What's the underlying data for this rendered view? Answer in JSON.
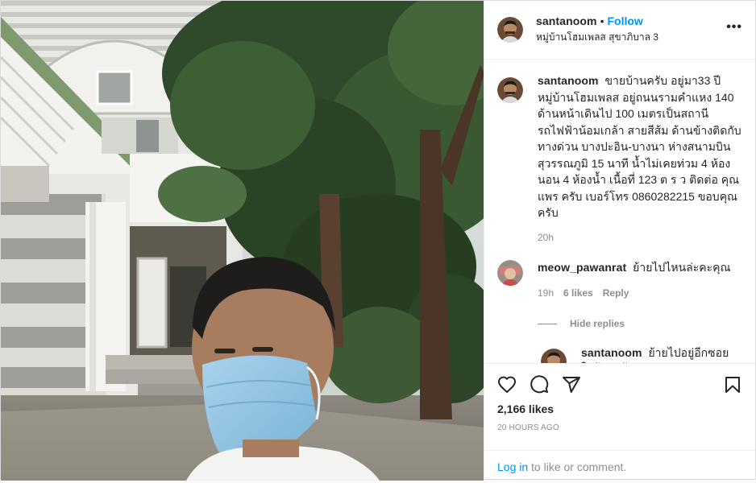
{
  "post": {
    "author": {
      "username": "santanoom",
      "follow_label": "Follow",
      "separator": "•",
      "location": "หมู่บ้านโฮมเพลส สุขาภิบาล 3"
    },
    "more_label": "•••",
    "caption": {
      "username": "santanoom",
      "text": "ขายบ้านครับ อยู่มา33 ปี หมู่บ้านโฮมเพลส อยู่ถนนรามคำแหง 140 ด้านหน้าเดินไป 100 เมตรเป็นสถานี รถไฟฟ้าน้อมเกล้า สายสีส้ม ด้านข้างติดกับทางด่วน บางปะอิน-บางนา ห่างสนามบิน สุวรรณภูมิ 15 นาที น้ำไม่เคยท่วม 4 ห้องนอน 4 ห้องน้ำ เนื้อที่ 123 ต ร ว ติดต่อ คุณแพร ครับ เบอร์โทร 0860282215 ขอบคุณครับ",
      "time": "20h"
    },
    "comments": [
      {
        "username": "meow_pawanrat",
        "text": "ย้ายไปไหนล่ะคะคุณ",
        "time": "19h",
        "likes": "6 likes",
        "reply_label": "Reply",
        "hide_replies_label": "Hide replies",
        "replies": [
          {
            "username": "santanoom",
            "text": "ย้ายไปอยู่อีกซอยใกล้ๆกันจ้า"
          }
        ]
      }
    ],
    "icons": {
      "like": "heart-icon",
      "comment": "comment-icon",
      "share": "paper-plane-icon",
      "save": "bookmark-icon",
      "more": "more-options-icon"
    },
    "likes_count": "2,166 likes",
    "timestamp": "20 HOURS AGO",
    "login_link": "Log in",
    "login_suffix": " to like or comment."
  },
  "colors": {
    "accent": "#0095f6",
    "text": "#262626",
    "muted": "#8e8e8e",
    "border": "#dbdbdb"
  }
}
